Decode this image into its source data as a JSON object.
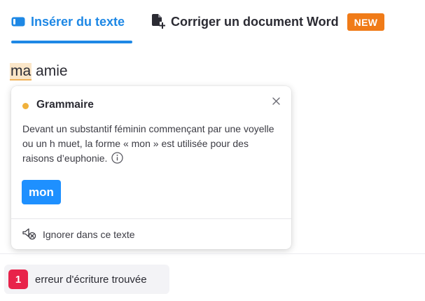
{
  "tabs": {
    "insert_label": "Insérer du texte",
    "word_label": "Corriger un document Word",
    "new_badge": "NEW"
  },
  "editor": {
    "error_word": "ma",
    "rest_text": " amie"
  },
  "popover": {
    "category": "Grammaire",
    "description": "Devant un substantif féminin commençant par une voyelle ou un h muet, la forme « mon » est utilisée pour des raisons d’euphonie.",
    "suggestion": "mon",
    "ignore_label": "Ignorer dans ce texte"
  },
  "status": {
    "error_count": "1",
    "error_label": "erreur d'écriture trouvée"
  },
  "colors": {
    "accent": "#1e88e5",
    "new_badge": "#f07b18",
    "grammar_dot": "#f0b13c",
    "error_highlight": "#fbe6c8",
    "count_badge": "#e8234a"
  },
  "icons": {
    "insert_tab": "text-box-icon",
    "word_tab": "document-add-icon",
    "close": "close-icon",
    "info": "info-icon",
    "ignore": "ignore-icon"
  }
}
